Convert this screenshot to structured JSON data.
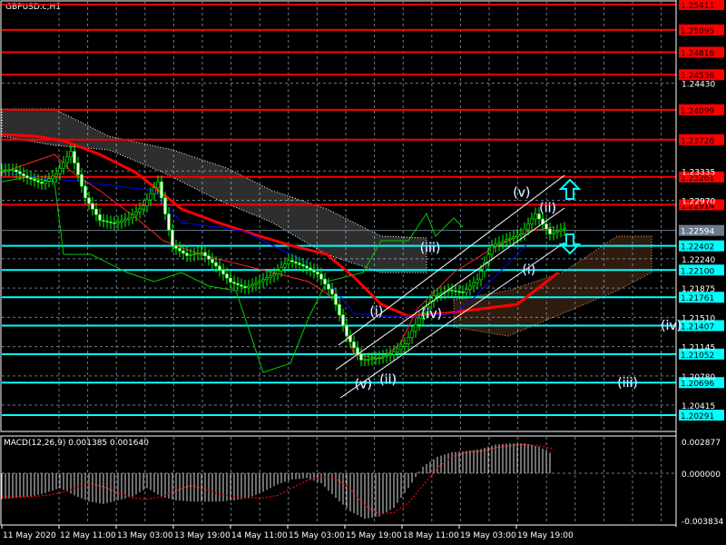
{
  "header": {
    "symbol_title": "GBPUSD.c,H1"
  },
  "colors": {
    "background": "#000000",
    "resistance": "#ff0000",
    "support": "#00ffff",
    "bull_candle": "#00ff00",
    "current_price": "#6a7b8c",
    "ma_slow": "#ff0000",
    "kijun": "#0000ff",
    "chikou": "#00cc00",
    "cloud_bull": "#ff9955",
    "cloud_bear": "#ffffff"
  },
  "chart_data": [
    {
      "type": "line",
      "title": "GBPUSD.c,H1",
      "price_axis": {
        "ticks": [
          "1.24430",
          "1.23335",
          "1.22970",
          "1.22240",
          "1.21875",
          "1.21510",
          "1.21145",
          "1.20780",
          "1.20415"
        ],
        "range": [
          1.2029,
          1.2541
        ]
      },
      "time_axis": {
        "ticks": [
          "11 May 2020",
          "12 May 11:00",
          "13 May 03:00",
          "13 May 19:00",
          "14 May 11:00",
          "15 May 03:00",
          "15 May 19:00",
          "18 May 11:00",
          "19 May 03:00",
          "19 May 19:00"
        ]
      },
      "current_price": "1.22594",
      "resistance_levels": [
        "1.25411",
        "1.25095",
        "1.24816",
        "1.24536",
        "1.24099",
        "1.23726",
        "1.23261",
        "1.22914"
      ],
      "support_levels": [
        "1.22402",
        "1.22100",
        "1.21761",
        "1.21407",
        "1.21052",
        "1.20696",
        "1.20291"
      ],
      "close_4h": [
        1.2335,
        1.2325,
        1.2318,
        1.233,
        1.2358,
        1.23,
        1.2272,
        1.2268,
        1.2275,
        1.229,
        1.232,
        1.224,
        1.2228,
        1.2232,
        1.2215,
        1.2195,
        1.2188,
        1.2196,
        1.2205,
        1.2222,
        1.2215,
        1.2205,
        1.218,
        1.2128,
        1.2098,
        1.21,
        1.2105,
        1.2118,
        1.215,
        1.2178,
        1.2185,
        1.2182,
        1.2198,
        1.224,
        1.2248,
        1.2255,
        1.228,
        1.2255,
        1.2262
      ],
      "wave_labels": [
        {
          "text": "(v)",
          "price": 1.2307,
          "bar": 35.8
        },
        {
          "text": "(ii)",
          "price": 1.2288,
          "bar": 37.6
        },
        {
          "text": "(iii)",
          "price": 1.2238,
          "bar": 29.5
        },
        {
          "text": "(i)",
          "price": 1.2211,
          "bar": 36.3
        },
        {
          "text": "(iv)",
          "price": 1.2156,
          "bar": 29.6
        },
        {
          "text": "(i)",
          "price": 1.2159,
          "bar": 25.8
        },
        {
          "text": "(v)",
          "price": 1.2068,
          "bar": 24.9
        },
        {
          "text": "(ii)",
          "price": 1.2074,
          "bar": 26.6
        },
        {
          "text": "(iv)",
          "price": 1.2141,
          "bar": 46.1
        },
        {
          "text": "(iii)",
          "price": 1.207,
          "bar": 43.1
        }
      ]
    },
    {
      "type": "bar",
      "title": "MACD(12,26,9) 0.001385 0.001640",
      "ticks": [
        "0.002877",
        "0.000000",
        "-0.003834"
      ],
      "range": [
        -0.003834,
        0.002877
      ],
      "histogram": [
        -0.0021,
        -0.002,
        -0.0019,
        -0.0016,
        -0.0012,
        -0.0018,
        -0.0023,
        -0.0025,
        -0.0022,
        -0.0019,
        -0.0012,
        -0.0019,
        -0.0022,
        -0.0023,
        -0.0023,
        -0.0023,
        -0.0022,
        -0.002,
        -0.0015,
        -0.0009,
        -0.0005,
        -0.0004,
        -0.0008,
        -0.002,
        -0.0031,
        -0.0037,
        -0.0035,
        -0.0028,
        -0.0012,
        0.0006,
        0.0015,
        0.0019,
        0.002,
        0.0022,
        0.0026,
        0.0027,
        0.0027,
        0.0024,
        0.0017
      ],
      "signal": [
        -0.0019,
        -0.0019,
        -0.0019,
        -0.0018,
        -0.0016,
        -0.0012,
        -0.0008,
        -0.0011,
        -0.0016,
        -0.002,
        -0.0021,
        -0.0019,
        -0.0014,
        -0.001,
        -0.0013,
        -0.0017,
        -0.0019,
        -0.002,
        -0.002,
        -0.0018,
        -0.0012,
        -0.0006,
        -0.0003,
        -0.0004,
        -0.0013,
        -0.0026,
        -0.0033,
        -0.0032,
        -0.0024,
        -0.001,
        0.0005,
        0.0015,
        0.0019,
        0.002,
        0.0023,
        0.0025,
        0.0026,
        0.0025,
        0.0022
      ]
    }
  ]
}
